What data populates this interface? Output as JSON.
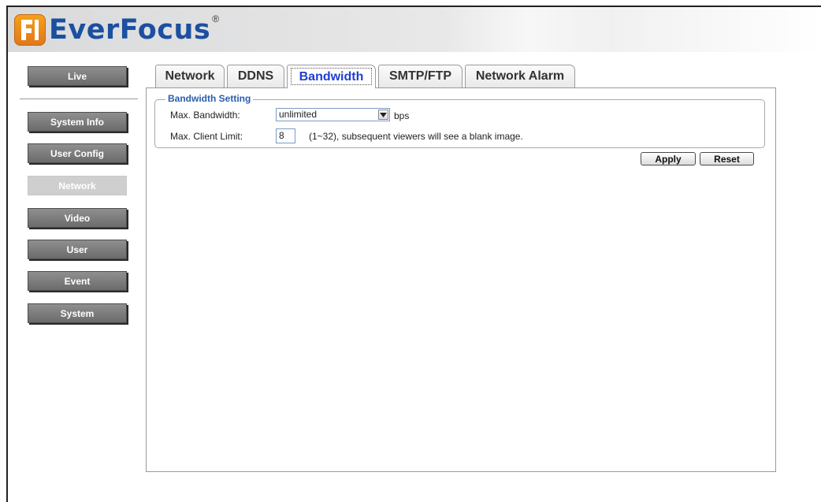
{
  "brand": {
    "name": "EverFocus",
    "registered": "®"
  },
  "sidebar": {
    "items": [
      {
        "label": "Live"
      },
      {
        "label": "System Info"
      },
      {
        "label": "User Config"
      },
      {
        "label": "Network",
        "active": true
      },
      {
        "label": "Video"
      },
      {
        "label": "User"
      },
      {
        "label": "Event"
      },
      {
        "label": "System"
      }
    ]
  },
  "tabs": [
    {
      "label": "Network"
    },
    {
      "label": "DDNS"
    },
    {
      "label": "Bandwidth",
      "active": true
    },
    {
      "label": "SMTP/FTP"
    },
    {
      "label": "Network Alarm"
    }
  ],
  "section": {
    "legend": "Bandwidth Setting",
    "max_bandwidth": {
      "label": "Max. Bandwidth:",
      "value": "unlimited",
      "unit": "bps"
    },
    "max_client": {
      "label": "Max. Client Limit:",
      "value": "8",
      "hint": "(1~32), subsequent viewers will see a blank image."
    }
  },
  "actions": {
    "apply": "Apply",
    "reset": "Reset"
  },
  "colors": {
    "accent": "#1e3fd0",
    "legend": "#2a5db0",
    "nav_button": "#7a7a7a",
    "nav_active": "#cfcfcf"
  }
}
